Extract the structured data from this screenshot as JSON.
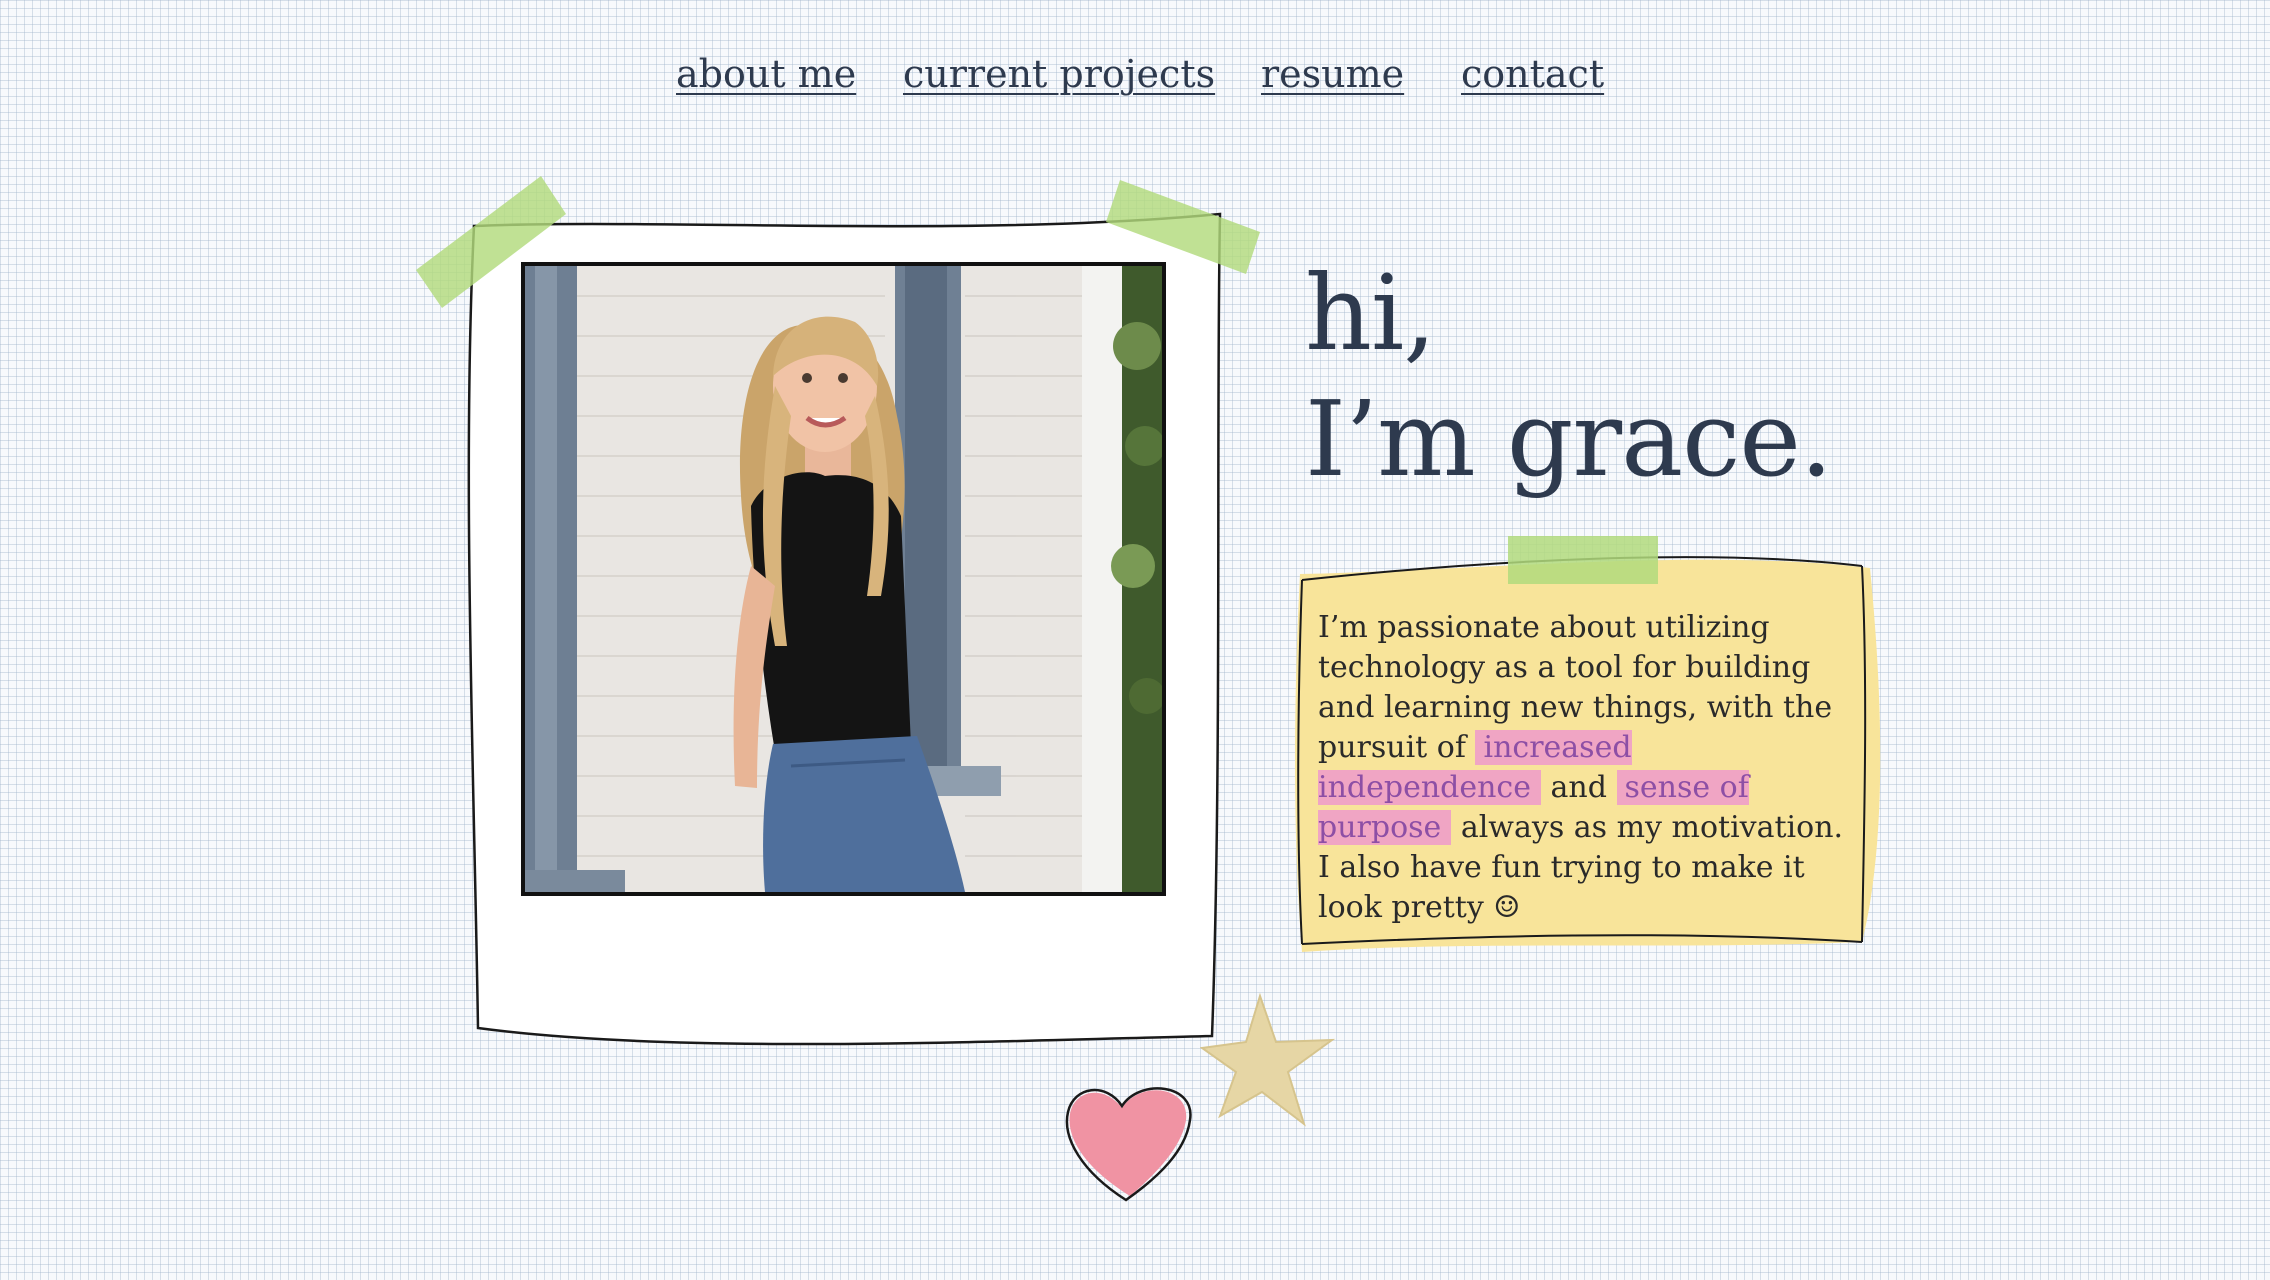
{
  "nav": {
    "items": [
      {
        "label": "about me"
      },
      {
        "label": "current projects"
      },
      {
        "label": "resume"
      },
      {
        "label": "contact"
      }
    ]
  },
  "hero": {
    "greeting_line1": "hi,",
    "greeting_line2": "I’m grace."
  },
  "note": {
    "text_before": "I’m passionate about utilizing technology as a tool for building and learning new things, with the pursuit of",
    "highlight1": "increased independence",
    "text_middle": "and",
    "highlight2": "sense of purpose",
    "text_after": "always as my motivation. I also have fun trying to make it look pretty ☺"
  },
  "colors": {
    "text": "#2e3a4e",
    "tape": "#bde28f",
    "note": "#f8e49a",
    "highlight": "#ec8ad6",
    "heart": "#f093a3",
    "star": "#e6d6a5"
  },
  "icons": {
    "star": "star-sticker-icon",
    "heart": "heart-sticker-icon"
  }
}
